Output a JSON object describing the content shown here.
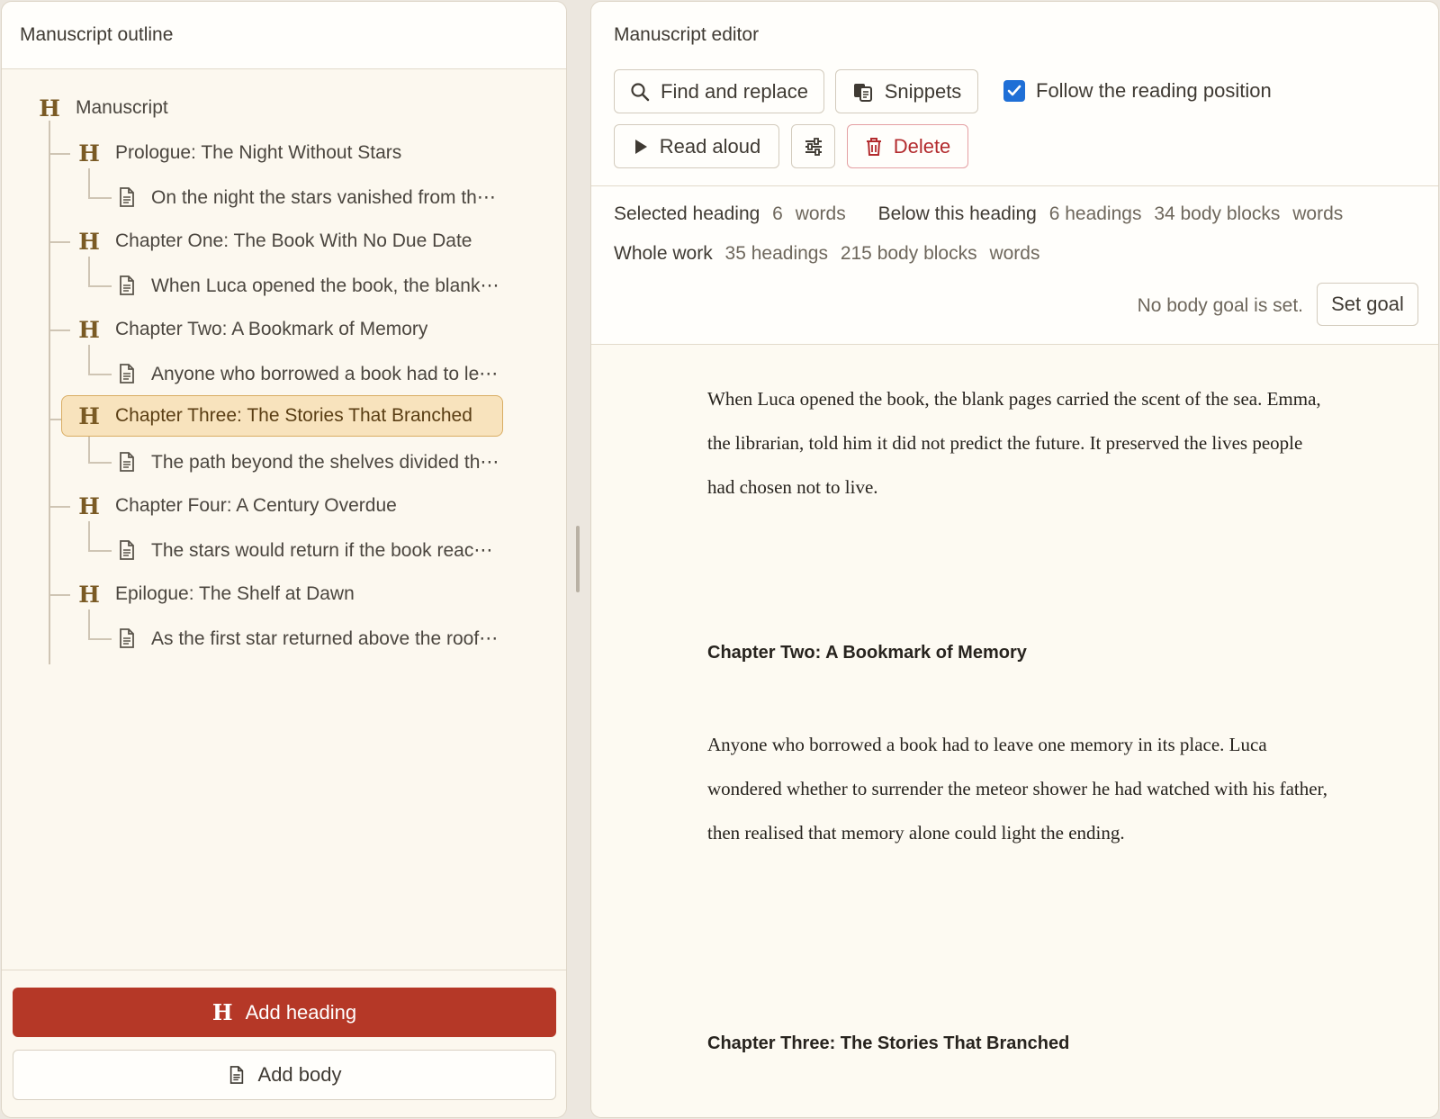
{
  "outline": {
    "title": "Manuscript outline",
    "root_label": "Manuscript",
    "items": [
      {
        "type": "heading",
        "label": "Prologue: The Night Without Stars"
      },
      {
        "type": "body",
        "label": "On the night the stars vanished from th⋯"
      },
      {
        "type": "heading",
        "label": "Chapter One: The Book With No Due Date"
      },
      {
        "type": "body",
        "label": "When Luca opened the book, the blank⋯"
      },
      {
        "type": "heading",
        "label": "Chapter Two: A Bookmark of Memory"
      },
      {
        "type": "body",
        "label": "Anyone who borrowed a book had to le⋯"
      },
      {
        "type": "heading",
        "label": "Chapter Three: The Stories That Branched",
        "selected": true
      },
      {
        "type": "body",
        "label": "The path beyond the shelves divided th⋯"
      },
      {
        "type": "heading",
        "label": "Chapter Four: A Century Overdue"
      },
      {
        "type": "body",
        "label": "The stars would return if the book reac⋯"
      },
      {
        "type": "heading",
        "label": "Epilogue: The Shelf at Dawn"
      },
      {
        "type": "body",
        "label": "As the first star returned above the roof⋯"
      }
    ],
    "add_heading_label": "Add heading",
    "add_body_label": "Add body"
  },
  "editor": {
    "title": "Manuscript editor",
    "toolbar": {
      "find_replace": "Find and replace",
      "snippets": "Snippets",
      "follow_label": "Follow the reading position",
      "follow_checked": true,
      "read_aloud": "Read aloud",
      "delete": "Delete"
    },
    "stats": {
      "selected_label": "Selected heading",
      "selected_count": "6",
      "selected_words": "words",
      "below_label": "Below this heading",
      "below_headings": "6 headings",
      "below_blocks": "34 body blocks",
      "below_words": "words",
      "whole_label": "Whole work",
      "whole_headings": "35 headings",
      "whole_blocks": "215 body blocks",
      "whole_words": "words",
      "goal_text": "No body goal is set.",
      "set_goal": "Set goal"
    },
    "content": {
      "para1": "When Luca opened the book, the blank pages carried the scent of the sea. Emma, the librarian, told him it did not predict the future. It preserved the lives people had chosen not to live.",
      "heading1": "Chapter Two: A Bookmark of Memory",
      "para2": "Anyone who borrowed a book had to leave one memory in its place. Luca wondered whether to surrender the meteor shower he had watched with his father, then realised that memory alone could light the ending.",
      "heading2": "Chapter Three: The Stories That Branched"
    }
  },
  "colors": {
    "accent": "#b53827",
    "selected_bg": "#f8e3bd",
    "checkbox": "#1f6fd6",
    "danger": "#b32b2e"
  }
}
